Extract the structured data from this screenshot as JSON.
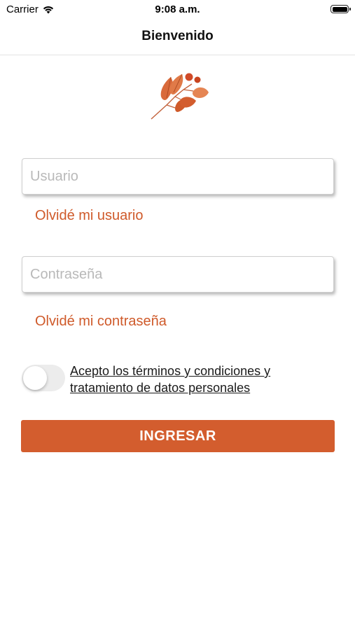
{
  "status_bar": {
    "carrier": "Carrier",
    "time": "9:08 a.m.",
    "wifi_icon": "wifi-icon",
    "battery_icon": "battery-icon",
    "battery_level": 1.0
  },
  "nav": {
    "title": "Bienvenido"
  },
  "logo": {
    "icon": "leaf-branch-logo",
    "color": "#d35d2e"
  },
  "form": {
    "username": {
      "placeholder": "Usuario",
      "value": ""
    },
    "forgot_username": "Olvidé mi usuario",
    "password": {
      "placeholder": "Contraseña",
      "value": ""
    },
    "forgot_password": "Olvidé mi contraseña",
    "terms_toggle_on": false,
    "terms_line1": "Acepto los términos y condiciones y",
    "terms_line2": "tratamiento de datos personales",
    "submit_label": "INGRESAR"
  },
  "colors": {
    "accent": "#d35d2e",
    "link": "#cf5a2a"
  }
}
